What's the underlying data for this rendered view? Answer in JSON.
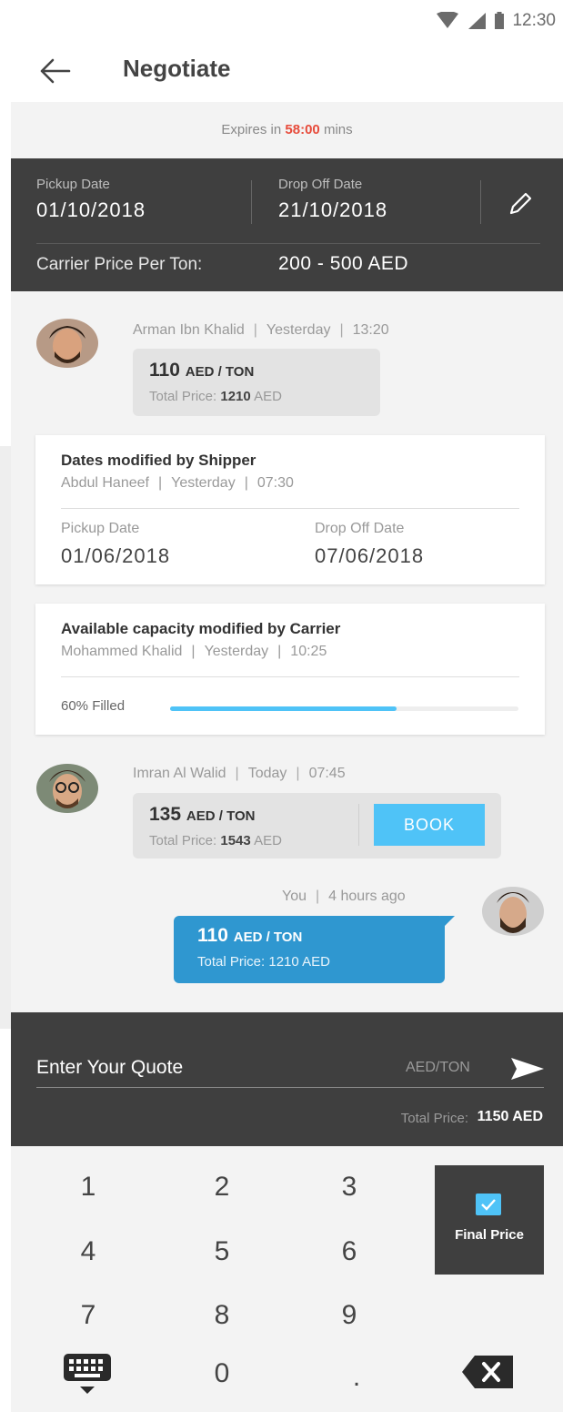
{
  "status_bar": {
    "time": "12:30"
  },
  "app_bar": {
    "title": "Negotiate"
  },
  "expires": {
    "prefix": "Expires in",
    "time": "58:00",
    "suffix": "mins"
  },
  "dates_panel": {
    "pickup_label": "Pickup Date",
    "pickup_value": "01/10/2018",
    "dropoff_label": "Drop Off Date",
    "dropoff_value": "21/10/2018",
    "carrier_label": "Carrier Price Per Ton:",
    "carrier_value": "200 - 500 AED"
  },
  "messages": [
    {
      "name": "Arman Ibn Khalid",
      "day": "Yesterday",
      "time": "13:20",
      "price": "110",
      "unit": "AED / TON",
      "total_label": "Total Price:",
      "total_value": "1210",
      "total_currency": "AED"
    },
    {
      "name": "Imran Al Walid",
      "day": "Today",
      "time": "07:45",
      "price": "135",
      "unit": "AED / TON",
      "total_label": "Total Price:",
      "total_value": "1543",
      "total_currency": "AED",
      "book_label": "BOOK"
    }
  ],
  "dates_card": {
    "title": "Dates modified by Shipper",
    "name": "Abdul Haneef",
    "day": "Yesterday",
    "time": "07:30",
    "pickup_label": "Pickup Date",
    "pickup_value": "01/06/2018",
    "dropoff_label": "Drop Off Date",
    "dropoff_value": "07/06/2018"
  },
  "capacity_card": {
    "title": "Available capacity modified by Carrier",
    "name": "Mohammed Khalid",
    "day": "Yesterday",
    "time": "10:25",
    "filled_label": "60% Filled",
    "filled_fraction": 0.65
  },
  "you_message": {
    "name": "You",
    "ago": "4 hours ago",
    "price": "110",
    "unit": "AED / TON",
    "total_label": "Total Price:",
    "total_value": "1210 AED"
  },
  "quote": {
    "placeholder": "Enter Your Quote",
    "unit": "AED/TON",
    "total_label": "Total Price:",
    "total_value": "1150 AED"
  },
  "keypad": {
    "keys": [
      "1",
      "2",
      "3",
      "4",
      "5",
      "6",
      "7",
      "8",
      "9",
      "0",
      "."
    ],
    "final_label": "Final Price"
  },
  "colors": {
    "accent": "#4fc3f7",
    "highlight": "#e74c3c",
    "dark_panel": "#3f3f3f",
    "you_bubble": "#2f97d0"
  }
}
